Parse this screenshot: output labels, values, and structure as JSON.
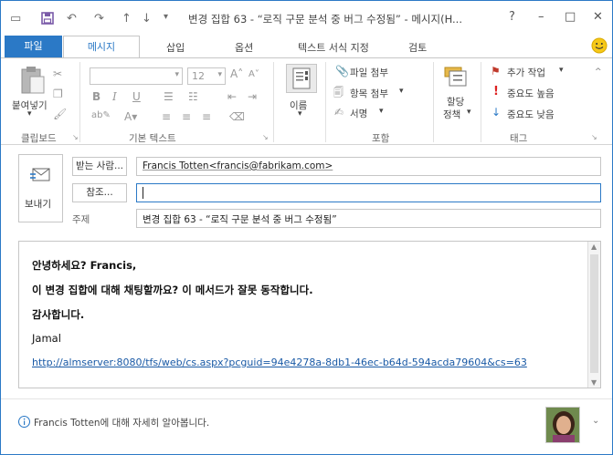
{
  "window": {
    "title": "변경 집합 63 - “로직 구문 분석 중 버그 수정됨” - 메시지(H...",
    "help_icon": "?",
    "minimize_icon": "–",
    "restore_icon": "□",
    "close_icon": "✕"
  },
  "quick_access": [
    "message-icon",
    "save-icon",
    "undo-icon",
    "redo-icon",
    "up-icon",
    "down-icon",
    "customize-icon"
  ],
  "tabs": {
    "file": "파일",
    "message": "메시지",
    "insert": "삽입",
    "options": "옵션",
    "format_text": "텍스트 서식 지정",
    "review": "검토"
  },
  "ribbon": {
    "clipboard": {
      "paste": "붙여넣기",
      "label": "클립보드"
    },
    "basic_text": {
      "font_size": "12",
      "label": "기본 텍스트"
    },
    "names": {
      "label": "이름"
    },
    "include": {
      "attach_file": "파일 첨부",
      "attach_item": "항목 첨부",
      "signature": "서명",
      "label": "포함"
    },
    "policy": {
      "label_line1": "할당",
      "label_line2": "정책"
    },
    "tags": {
      "follow_up": "추가 작업",
      "high_importance": "중요도 높음",
      "low_importance": "중요도 낮음",
      "label": "태그"
    }
  },
  "compose": {
    "send": "보내기",
    "to_button": "받는 사람...",
    "cc_button": "참조...",
    "subject_label": "주제",
    "to_value": "Francis Totten<francis@fabrikam.com>",
    "cc_value": "",
    "subject_value": "변경 집합 63 - “로직 구문 분석 중 버그 수정됨”"
  },
  "body": {
    "greeting": "안녕하세요? Francis,",
    "line1": "이 변경 집합에 대해 채팅할까요? 이 메서드가 잘못 동작합니다.",
    "thanks": "감사합니다.",
    "signature": "Jamal",
    "link": "http://almserver:8080/tfs/web/cs.aspx?pcguid=94e4278a-8db1-46ec-b64d-594acda79604&cs=63"
  },
  "footer": {
    "info": "Francis Totten에 대해 자세히 알아봅니다."
  },
  "colors": {
    "accent": "#2b79c6",
    "link": "#1a5aa6",
    "high_importance": "#d23",
    "flag": "#c0392b"
  }
}
